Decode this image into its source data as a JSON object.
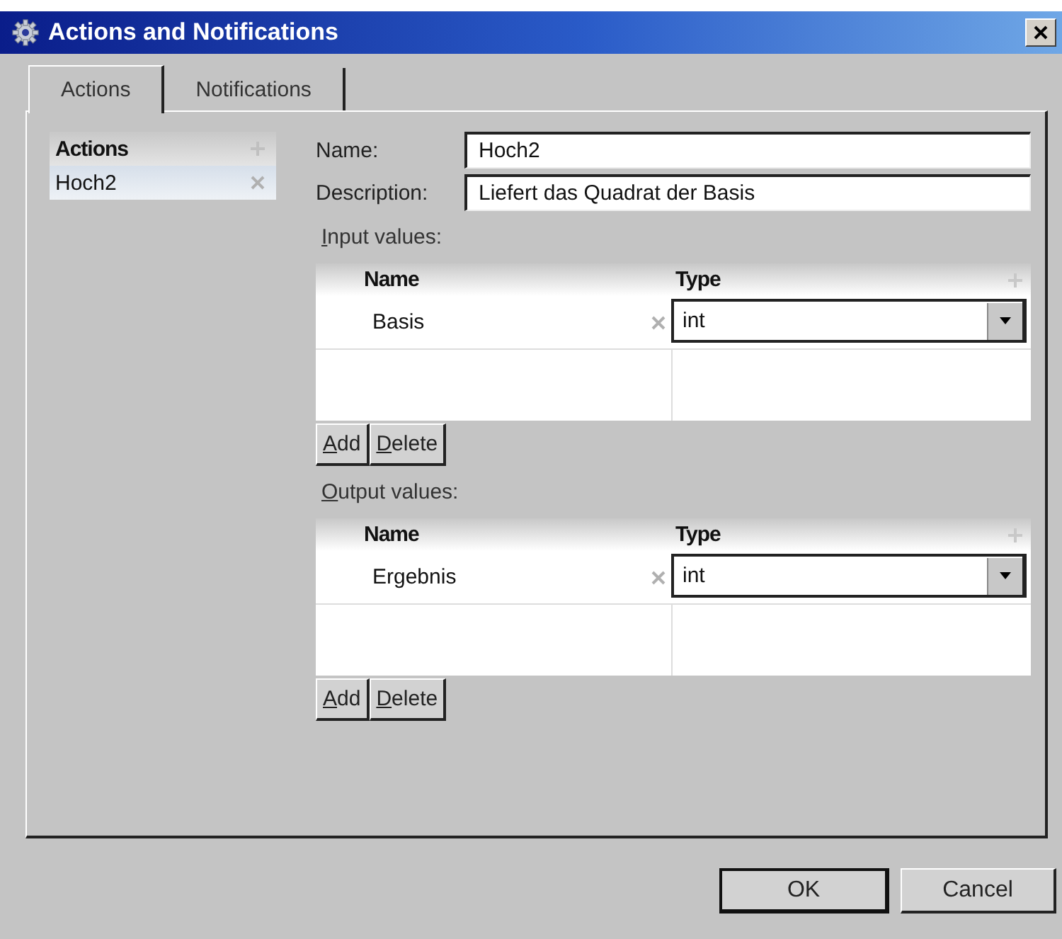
{
  "window": {
    "title": "Actions and Notifications"
  },
  "tabs": [
    {
      "label": "Actions",
      "selected": true
    },
    {
      "label": "Notifications",
      "selected": false
    }
  ],
  "action_list": {
    "header": "Actions",
    "items": [
      {
        "label": "Hoch2",
        "selected": true
      }
    ]
  },
  "name_field": {
    "label": "Name:",
    "value": "Hoch2"
  },
  "description_field": {
    "label": "Description:",
    "value": "Liefert das Quadrat der Basis"
  },
  "value_groups": [
    {
      "label": "Input values:",
      "mnemonic": true,
      "columns": [
        "Name",
        "Type"
      ],
      "rows": [
        {
          "name": "Basis",
          "type": "int"
        }
      ],
      "buttons": [
        {
          "label": "Add",
          "mnemonic": true
        },
        {
          "label": "Delete",
          "mnemonic": true
        }
      ]
    },
    {
      "label": "Output values:",
      "mnemonic": true,
      "columns": [
        "Name",
        "Type"
      ],
      "rows": [
        {
          "name": "Ergebnis",
          "type": "int"
        }
      ],
      "buttons": [
        {
          "label": "Add",
          "mnemonic": true
        },
        {
          "label": "Delete",
          "mnemonic": true
        }
      ]
    }
  ],
  "buttons": [
    {
      "label": "OK",
      "default": true
    },
    {
      "label": "Cancel",
      "default": false
    }
  ]
}
